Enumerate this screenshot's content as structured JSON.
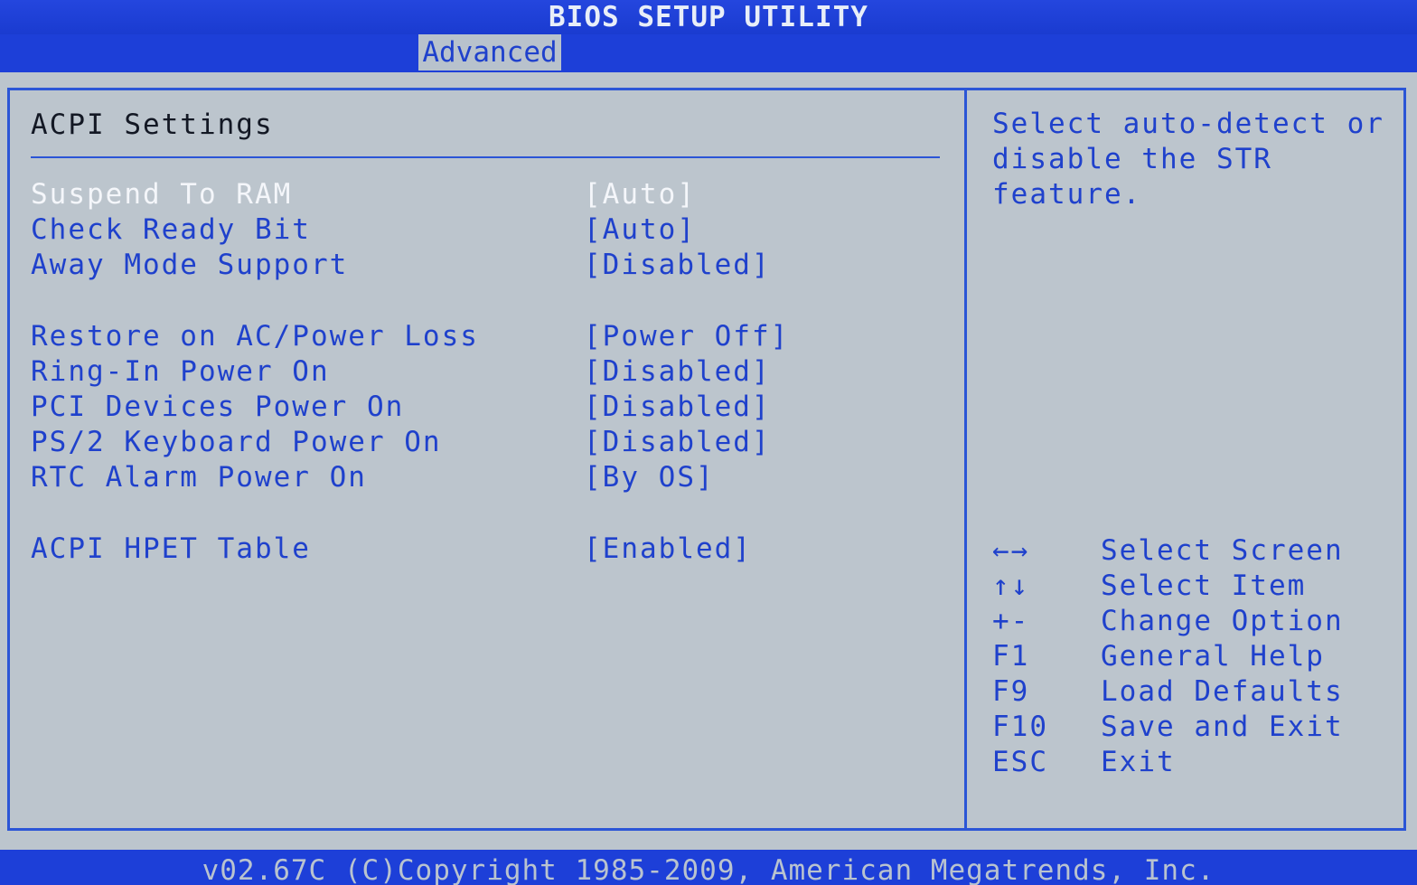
{
  "window": {
    "title": "BIOS SETUP UTILITY"
  },
  "menu": {
    "active_tab": "Advanced"
  },
  "section": {
    "title": "ACPI Settings"
  },
  "settings": [
    {
      "label": "Suspend To RAM",
      "value": "[Auto]",
      "selected": true
    },
    {
      "label": "Check Ready Bit",
      "value": "[Auto]"
    },
    {
      "label": "Away Mode Support",
      "value": "[Disabled]"
    },
    {
      "label": "Restore on AC/Power Loss",
      "value": "[Power Off]"
    },
    {
      "label": "Ring-In Power On",
      "value": "[Disabled]"
    },
    {
      "label": "PCI Devices Power On",
      "value": "[Disabled]"
    },
    {
      "label": "PS/2 Keyboard Power On",
      "value": "[Disabled]"
    },
    {
      "label": "RTC Alarm Power On",
      "value": "[By OS]"
    },
    {
      "label": "ACPI HPET Table",
      "value": "[Enabled]"
    }
  ],
  "help": {
    "lines": [
      "Select auto-detect or",
      "disable the STR",
      "feature."
    ]
  },
  "keys": [
    {
      "key": "←→",
      "desc": "Select Screen"
    },
    {
      "key": "↑↓",
      "desc": "Select Item"
    },
    {
      "key": "+-",
      "desc": "Change Option"
    },
    {
      "key": "F1",
      "desc": "General Help"
    },
    {
      "key": "F9",
      "desc": "Load Defaults"
    },
    {
      "key": "F10",
      "desc": "Save and Exit"
    },
    {
      "key": "ESC",
      "desc": "Exit"
    }
  ],
  "footer": {
    "text": "v02.67C (C)Copyright 1985-2009, American Megatrends, Inc."
  },
  "colors": {
    "bar_blue": "#1d3fd8",
    "panel_gray": "#bcc5cd",
    "text_blue": "#1f41cc",
    "selected_white": "#f4f6fa"
  }
}
